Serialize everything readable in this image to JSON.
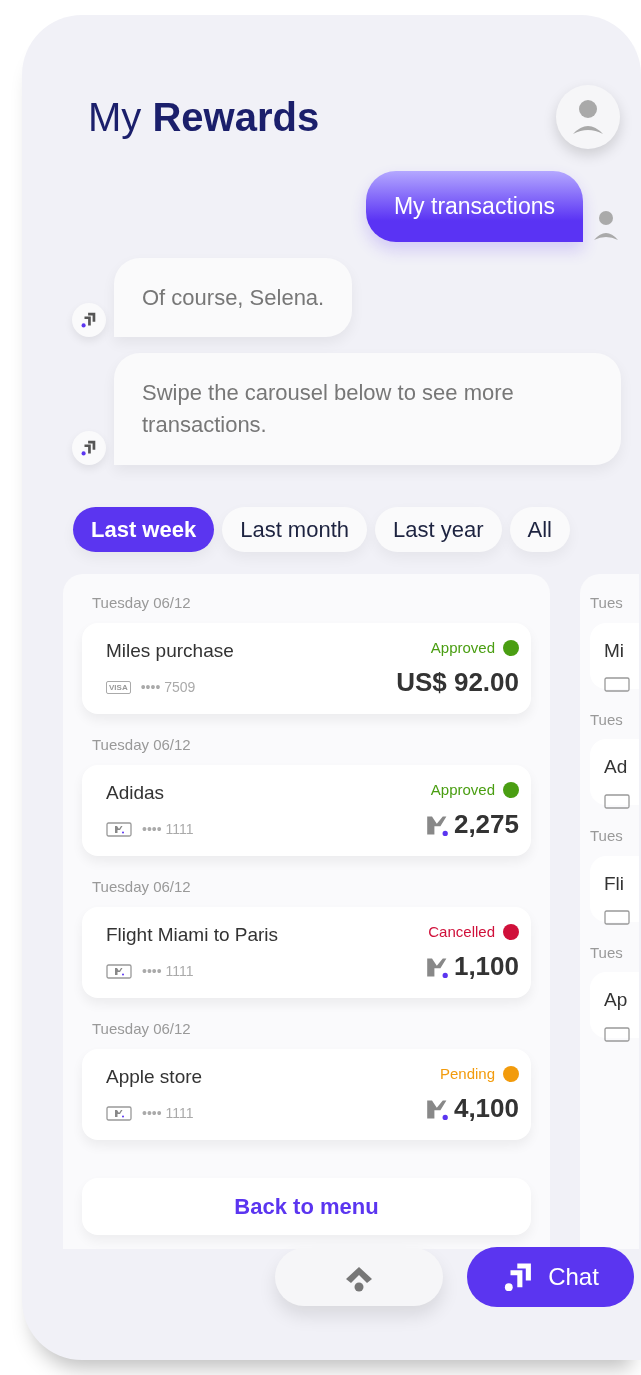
{
  "header": {
    "title": "My **Rewards**"
  },
  "messages": [
    {
      "kind": "user",
      "text": "My transactions"
    },
    {
      "kind": "bot",
      "text": "Of course, Selena."
    },
    {
      "kind": "bot",
      "text": "Swipe the carousel below to see more transactions."
    }
  ],
  "filters": [
    {
      "label": "Last week",
      "selected": true
    },
    {
      "label": "Last month",
      "selected": false
    },
    {
      "label": "Last year",
      "selected": false
    },
    {
      "label": "All",
      "selected": false
    }
  ],
  "transactions": [
    {
      "date": "Tuesday 06/12",
      "name": "Miles purchase",
      "card": {
        "kind": "visa",
        "brand": "VISA",
        "number": "•••• 7509"
      },
      "status": "Approved",
      "color": "#4a9e12",
      "amount": {
        "kind": "cash",
        "text": "US$ 92.00"
      }
    },
    {
      "date": "Tuesday 06/12",
      "name": "Adidas",
      "card": {
        "kind": "miles",
        "number": "•••• 1111"
      },
      "status": "Approved",
      "color": "#4a9e12",
      "amount": {
        "kind": "miles",
        "text": "2,275"
      }
    },
    {
      "date": "Tuesday 06/12",
      "name": "Flight Miami to Paris",
      "card": {
        "kind": "miles",
        "number": "•••• 1111"
      },
      "status": "Cancelled",
      "color": "#d0103a",
      "amount": {
        "kind": "miles",
        "text": "1,100"
      }
    },
    {
      "date": "Tuesday 06/12",
      "name": "Apple store",
      "card": {
        "kind": "miles",
        "number": "•••• 1111"
      },
      "status": "Pending",
      "color": "#f29b0c",
      "amount": {
        "kind": "miles",
        "text": "4,100"
      }
    }
  ],
  "back_button": "Back to menu",
  "next_card": {
    "rows": [
      {
        "date": "Tues",
        "name": "Mi"
      },
      {
        "date": "Tues",
        "name": "Ad"
      },
      {
        "date": "Tues",
        "name": "Fli"
      },
      {
        "date": "Tues",
        "name": "Ap"
      }
    ]
  },
  "bottom_bar": {
    "chat_button": "Chat"
  }
}
